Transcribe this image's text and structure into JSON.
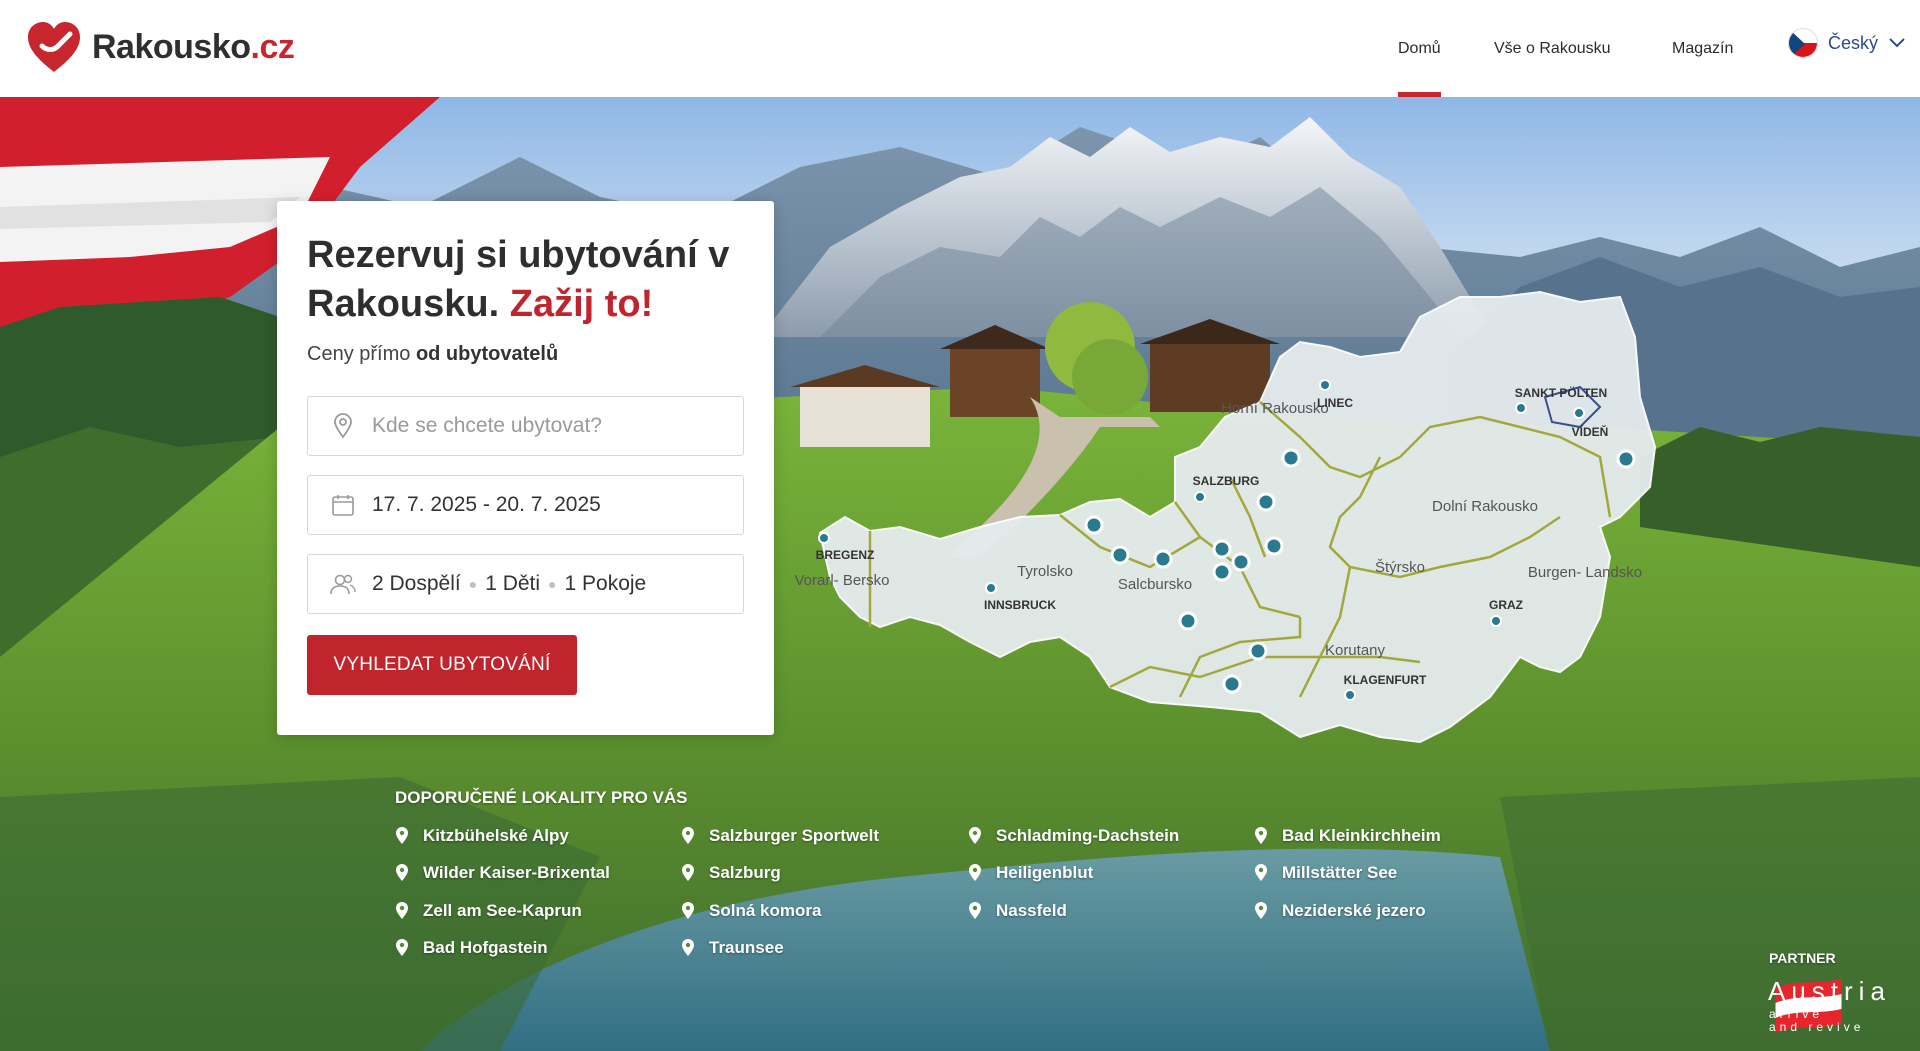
{
  "header": {
    "logo_text_main": "Rakousko",
    "logo_text_tld": ".cz",
    "nav": [
      {
        "label": "Domů",
        "active": true
      },
      {
        "label": "Vše o Rakousku",
        "active": false
      },
      {
        "label": "Magazín",
        "active": false
      }
    ],
    "language": "Český"
  },
  "booking": {
    "title_line1": "Rezervuj si ubytování v",
    "title_line2": "Rakousku.",
    "title_accent": "Zažij to!",
    "subtitle_prefix": "Ceny přímo",
    "subtitle_bold": "od ubytovatelů",
    "location_placeholder": "Kde se chcete ubytovat?",
    "dates": "17. 7. 2025 - 20. 7. 2025",
    "guests": {
      "adults": "2 Dospělí",
      "children": "1 Děti",
      "rooms": "1 Pokoje"
    },
    "search_label": "VYHLEDAT UBYTOVÁNÍ"
  },
  "map": {
    "regions": [
      "Horní Rakousko",
      "Salcbursko",
      "Tyrolsko",
      "Vorarl- Bersko",
      "Štýrsko",
      "Dolní Rakousko",
      "Korutany",
      "Burgen- Landsko"
    ],
    "cities": [
      "LINEC",
      "SALZBURG",
      "BREGENZ",
      "INNSBRUCK",
      "SANKT PÖLTEN",
      "VÍDEŇ",
      "GRAZ",
      "KLAGENFURT"
    ]
  },
  "recommended": {
    "title": "DOPORUČENÉ LOKALITY PRO VÁS",
    "columns": [
      [
        "Kitzbühelské Alpy",
        "Wilder Kaiser-Brixental",
        "Zell am See-Kaprun",
        "Bad Hofgastein"
      ],
      [
        "Salzburger Sportwelt",
        "Salzburg",
        "Solná komora",
        "Traunsee"
      ],
      [
        "Schladming-Dachstein",
        "Heiligenblut",
        "Nassfeld"
      ],
      [
        "Bad Kleinkirchheim",
        "Millstätter See",
        "Neziderské jezero"
      ]
    ]
  },
  "partner": {
    "label": "PARTNER",
    "brand": "Austria",
    "tagline_1": "arrive",
    "tagline_2": "and revive"
  },
  "colors": {
    "accent": "#c0242c",
    "link": "#2a4d8a",
    "map_pin": "#2a7a8f"
  }
}
